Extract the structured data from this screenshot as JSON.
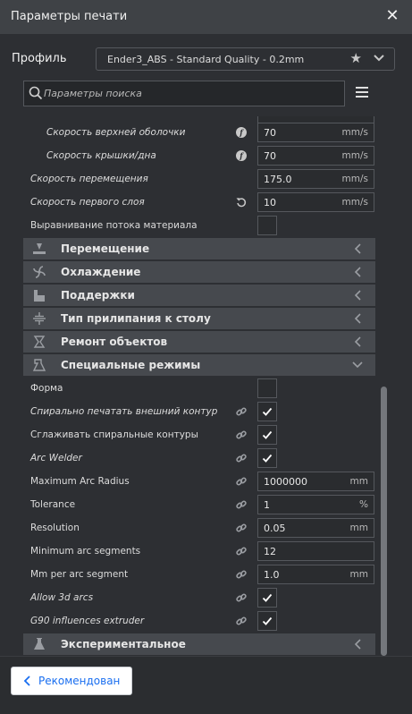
{
  "window": {
    "title": "Параметры печати"
  },
  "profile": {
    "label": "Профиль",
    "value": "Ender3_ABS - Standard Quality - 0.2mm"
  },
  "search": {
    "placeholder": "Параметры поиска"
  },
  "settings_top": [
    {
      "label": "Скорость верхней оболочки",
      "value": "70",
      "unit": "mm/s",
      "icon": "function-icon",
      "italic": true,
      "indent": 1
    },
    {
      "label": "Скорость крышки/дна",
      "value": "70",
      "unit": "mm/s",
      "icon": "function-icon",
      "italic": true,
      "indent": 1
    },
    {
      "label": "Скорость перемещения",
      "value": "175.0",
      "unit": "mm/s",
      "icon": "",
      "italic": true,
      "indent": 0
    },
    {
      "label": "Скорость первого слоя",
      "value": "10",
      "unit": "mm/s",
      "icon": "reset-icon",
      "italic": true,
      "indent": 0
    },
    {
      "label": "Выравнивание потока материала",
      "checked": false,
      "icon": "",
      "italic": false,
      "indent": 0
    }
  ],
  "categories": [
    {
      "label": "Перемещение",
      "icon": "travel-icon",
      "expanded": false
    },
    {
      "label": "Охлаждение",
      "icon": "fan-icon",
      "expanded": false
    },
    {
      "label": "Поддержки",
      "icon": "support-icon",
      "expanded": false
    },
    {
      "label": "Тип прилипания к столу",
      "icon": "adhesion-icon",
      "expanded": false
    },
    {
      "label": "Ремонт объектов",
      "icon": "mesh-fix-icon",
      "expanded": false
    },
    {
      "label": "Специальные режимы",
      "icon": "special-modes-icon",
      "expanded": true
    }
  ],
  "special_settings": [
    {
      "label": "Форма",
      "type": "checkbox",
      "checked": false,
      "italic": false,
      "icon": ""
    },
    {
      "label": "Спирально печатать внешний контур",
      "type": "checkbox",
      "checked": true,
      "italic": true,
      "icon": "link-icon"
    },
    {
      "label": "Сглаживать спиральные контуры",
      "type": "checkbox",
      "checked": true,
      "italic": false,
      "icon": "link-icon"
    },
    {
      "label": "Arc Welder",
      "type": "checkbox",
      "checked": true,
      "italic": true,
      "icon": "link-icon"
    },
    {
      "label": "Maximum Arc Radius",
      "type": "value",
      "value": "1000000",
      "unit": "mm",
      "italic": false,
      "icon": "link-icon"
    },
    {
      "label": "Tolerance",
      "type": "value",
      "value": "1",
      "unit": "%",
      "italic": false,
      "icon": "link-icon"
    },
    {
      "label": "Resolution",
      "type": "value",
      "value": "0.05",
      "unit": "mm",
      "italic": false,
      "icon": "link-icon"
    },
    {
      "label": "Minimum arc segments",
      "type": "value",
      "value": "12",
      "unit": "",
      "italic": false,
      "icon": "link-icon"
    },
    {
      "label": "Mm per arc segment",
      "type": "value",
      "value": "1.0",
      "unit": "mm",
      "italic": false,
      "icon": "link-icon"
    },
    {
      "label": "Allow 3d arcs",
      "type": "checkbox",
      "checked": true,
      "italic": true,
      "icon": "link-icon"
    },
    {
      "label": "G90 influences extruder",
      "type": "checkbox",
      "checked": true,
      "italic": true,
      "icon": "link-icon"
    }
  ],
  "experimental": {
    "label": "Экспериментальное",
    "icon": "flask-icon",
    "expanded": false
  },
  "footer": {
    "recommended_label": "Рекомендован"
  },
  "colors": {
    "accent": "#196ef0",
    "category_bg": "#46494e",
    "panel_bg": "#2d2f33"
  }
}
